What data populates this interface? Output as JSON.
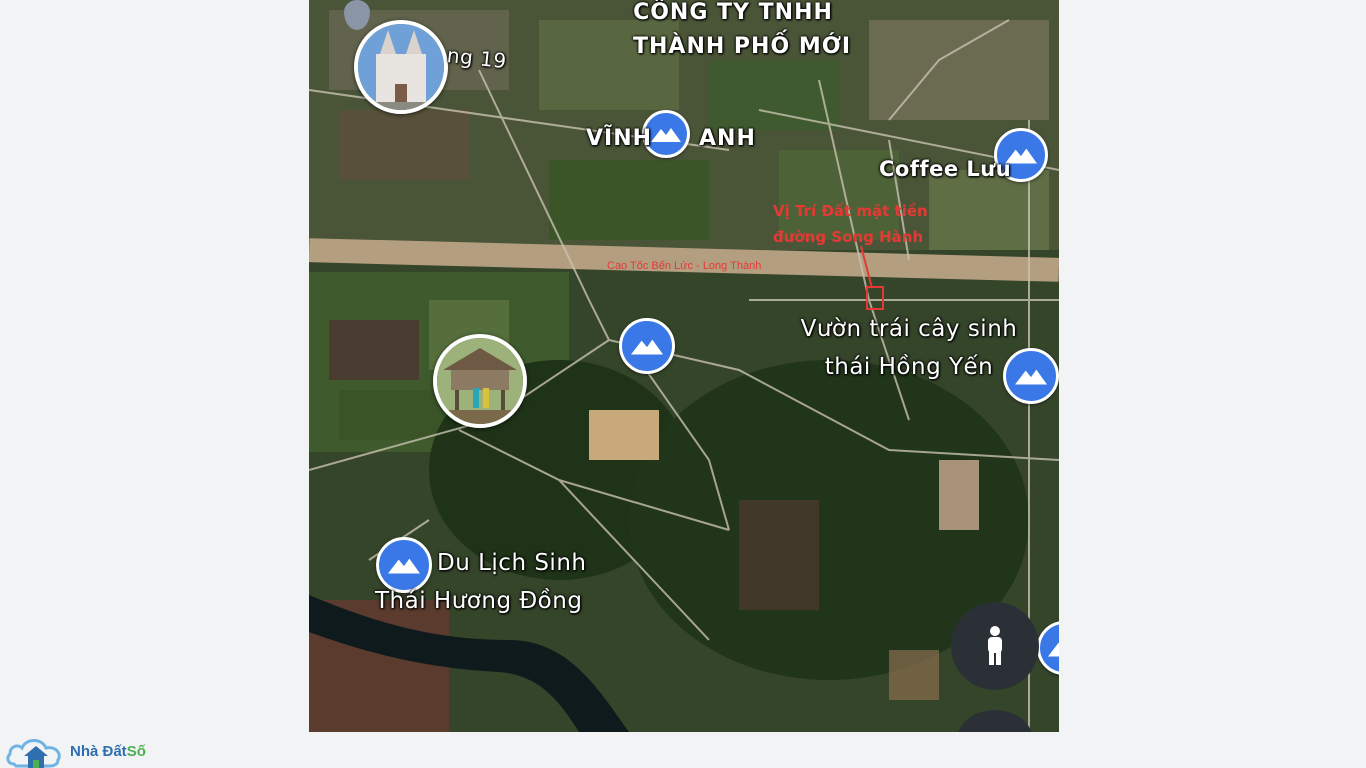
{
  "map": {
    "labels": {
      "company_line1": "CÔNG TY TNHH",
      "company_line2": "THÀNH PHỐ MỚI",
      "road19": "ng 19",
      "vinh_thanh_left": "VĨNH",
      "vinh_thanh_right": "ANH",
      "coffee": "Coffee Lưu",
      "orchard_line1": "Vườn trái cây sinh",
      "orchard_line2": "thái Hồng Yến",
      "tourism_line1": "Du Lịch Sinh",
      "tourism_line2": "Thái Hương Đồng"
    },
    "annotation": {
      "line1": "Vị Trí Đất mặt tiền",
      "line2": "đường Song Hành",
      "road_name": "Cao Tốc Bến Lức - Long Thành",
      "color": "#e53935"
    },
    "pins": [
      {
        "name": "vinh-thanh-pin",
        "icon": "mountain-icon"
      },
      {
        "name": "coffee-pin",
        "icon": "mountain-icon"
      },
      {
        "name": "center-pin",
        "icon": "mountain-icon"
      },
      {
        "name": "orchard-pin",
        "icon": "mountain-icon"
      },
      {
        "name": "tourism-pin",
        "icon": "mountain-icon"
      },
      {
        "name": "edge-pin",
        "icon": "mountain-icon"
      }
    ],
    "pin_color": "#3b78e7"
  },
  "logo": {
    "text_a": "Nhà Đất",
    "text_b": "Số",
    "icon": "house-cloud-icon"
  }
}
